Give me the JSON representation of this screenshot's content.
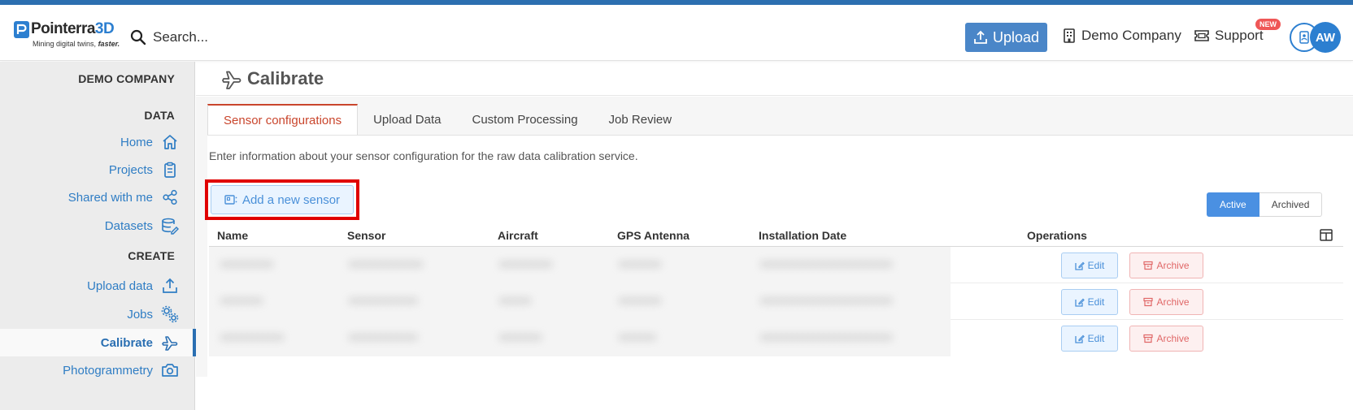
{
  "header": {
    "logo_name_dark": "Pointerra",
    "logo_name_accent": "3D",
    "logo_tagline": "Mining digital twins,",
    "logo_tagline_em": "faster.",
    "search_placeholder": "Search...",
    "upload_label": "Upload",
    "company_label": "Demo Company",
    "support_label": "Support",
    "new_badge": "NEW",
    "avatar_initials": "AW",
    "brand_color": "#2c7fd0"
  },
  "sidebar": {
    "org_heading": "DEMO COMPANY",
    "data_heading": "DATA",
    "create_heading": "CREATE",
    "data_items": [
      {
        "label": "Home",
        "icon": "home-icon"
      },
      {
        "label": "Projects",
        "icon": "clipboard-icon"
      },
      {
        "label": "Shared with me",
        "icon": "share-icon"
      },
      {
        "label": "Datasets",
        "icon": "datasets-icon"
      }
    ],
    "create_items": [
      {
        "label": "Upload data",
        "icon": "upload-icon"
      },
      {
        "label": "Jobs",
        "icon": "gears-icon"
      },
      {
        "label": "Calibrate",
        "icon": "plane-icon",
        "active": true
      },
      {
        "label": "Photogrammetry",
        "icon": "camera-icon"
      }
    ]
  },
  "page": {
    "title": "Calibrate",
    "tabs": [
      {
        "label": "Sensor configurations",
        "active": true
      },
      {
        "label": "Upload Data"
      },
      {
        "label": "Custom Processing"
      },
      {
        "label": "Job Review"
      }
    ],
    "description": "Enter information about your sensor configuration for the raw data calibration service.",
    "add_sensor_label": "Add a new sensor",
    "filter_active": "Active",
    "filter_archived": "Archived"
  },
  "table": {
    "columns": [
      "Name",
      "Sensor",
      "Aircraft",
      "GPS Antenna",
      "Installation Date",
      "Operations"
    ],
    "edit_label": "Edit",
    "archive_label": "Archive",
    "rows": 3
  }
}
